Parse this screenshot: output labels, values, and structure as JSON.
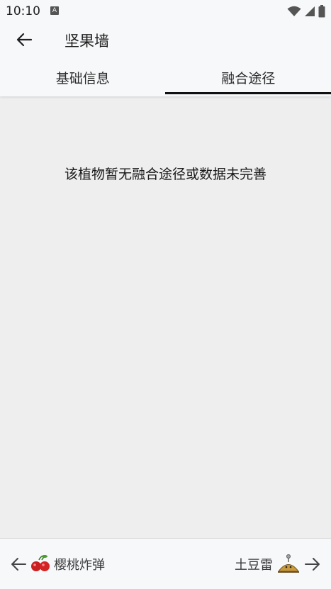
{
  "status": {
    "time": "10:10",
    "notif_badge": "A"
  },
  "appbar": {
    "title": "坚果墙"
  },
  "tabs": [
    {
      "label": "基础信息",
      "selected": false
    },
    {
      "label": "融合途径",
      "selected": true
    }
  ],
  "content": {
    "empty_message": "该植物暂无融合途径或数据未完善"
  },
  "bottom_nav": {
    "prev": {
      "label": "樱桃炸弹",
      "icon": "cherry-bomb-icon"
    },
    "next": {
      "label": "土豆雷",
      "icon": "potato-mine-icon"
    }
  },
  "colors": {
    "background": "#eeeeee",
    "bar": "#f7f8fa",
    "indicator": "#111111"
  }
}
